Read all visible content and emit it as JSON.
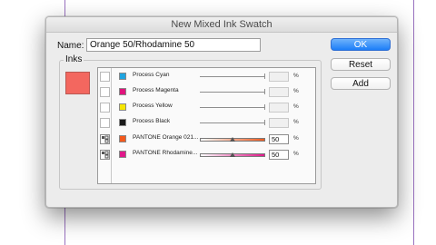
{
  "dialog": {
    "title": "New Mixed Ink Swatch",
    "name_label": "Name:",
    "name_value": "Orange 50/Rhodamine 50",
    "inks_label": "Inks",
    "preview_color": "#f3675f"
  },
  "buttons": {
    "ok": "OK",
    "reset": "Reset",
    "add": "Add"
  },
  "inks": [
    {
      "name": "Process Cyan",
      "color": "#1ea4e0",
      "value": "",
      "percent_sign": "%",
      "included": false,
      "spot": false
    },
    {
      "name": "Process Magenta",
      "color": "#e0147c",
      "value": "",
      "percent_sign": "%",
      "included": false,
      "spot": false
    },
    {
      "name": "Process Yellow",
      "color": "#f6e600",
      "value": "",
      "percent_sign": "%",
      "included": false,
      "spot": false
    },
    {
      "name": "Process Black",
      "color": "#1a1a1a",
      "value": "",
      "percent_sign": "%",
      "included": false,
      "spot": false
    },
    {
      "name": "PANTONE Orange 021...",
      "color": "#f4591c",
      "value": "50",
      "percent_sign": "%",
      "included": true,
      "spot": true,
      "level": 0.5,
      "gradient_end": "#ee5a1e"
    },
    {
      "name": "PANTONE Rhodamine...",
      "color": "#e0188a",
      "value": "50",
      "percent_sign": "%",
      "included": true,
      "spot": true,
      "level": 0.5,
      "gradient_end": "#e0188a"
    }
  ]
}
